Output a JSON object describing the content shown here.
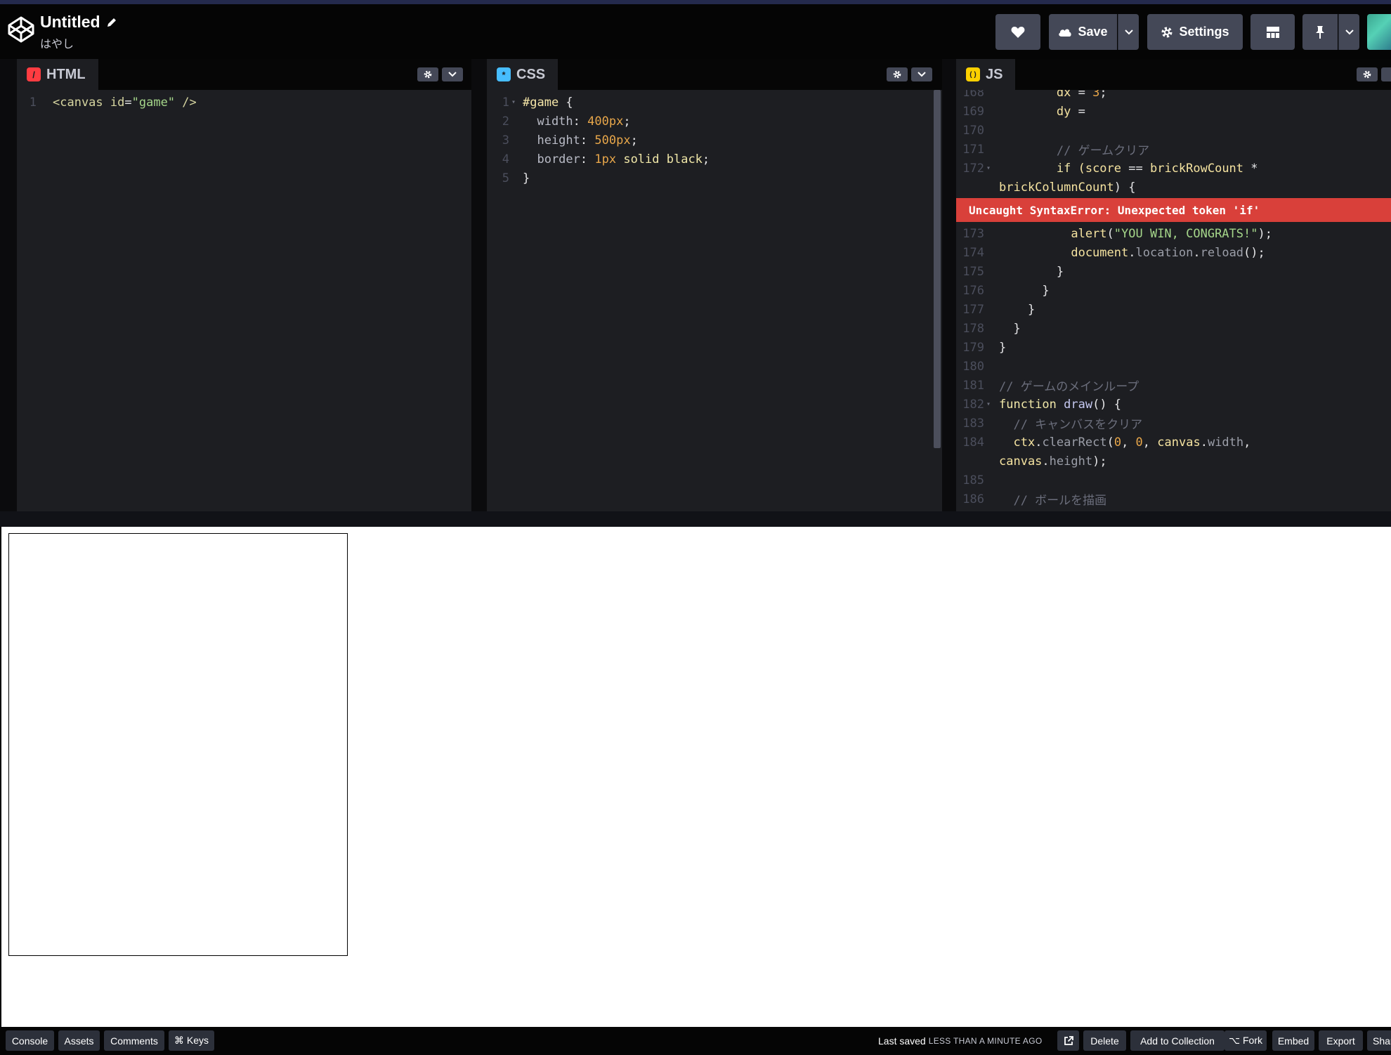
{
  "header": {
    "title": "Untitled",
    "author": "はやし",
    "save_label": "Save",
    "settings_label": "Settings",
    "heart_icon": "heart-icon",
    "cloud_icon": "cloud-icon",
    "gear_icon": "gear-icon",
    "layout_icon": "layout-icon",
    "pin_icon": "pin-icon"
  },
  "editors": {
    "html": {
      "label": "HTML",
      "badge": "/",
      "badge_color": "#ff3c41",
      "lines": [
        {
          "n": "1",
          "segments": [
            {
              "t": "<canvas ",
              "c": "tag"
            },
            {
              "t": "id",
              "c": "attr"
            },
            {
              "t": "=",
              "c": "plain"
            },
            {
              "t": "\"game\"",
              "c": "str"
            },
            {
              "t": " />",
              "c": "tag"
            }
          ]
        }
      ]
    },
    "css": {
      "label": "CSS",
      "badge": "*",
      "badge_color": "#47bdff",
      "lines": [
        {
          "n": "1",
          "fold": true,
          "segments": [
            {
              "t": "#game",
              "c": "sel"
            },
            {
              "t": " {",
              "c": "plain"
            }
          ]
        },
        {
          "n": "2",
          "segments": [
            {
              "t": "  width",
              "c": "prop"
            },
            {
              "t": ": ",
              "c": "plain"
            },
            {
              "t": "400px",
              "c": "num"
            },
            {
              "t": ";",
              "c": "plain"
            }
          ]
        },
        {
          "n": "3",
          "segments": [
            {
              "t": "  height",
              "c": "prop"
            },
            {
              "t": ": ",
              "c": "plain"
            },
            {
              "t": "500px",
              "c": "num"
            },
            {
              "t": ";",
              "c": "plain"
            }
          ]
        },
        {
          "n": "4",
          "segments": [
            {
              "t": "  border",
              "c": "prop"
            },
            {
              "t": ": ",
              "c": "plain"
            },
            {
              "t": "1px",
              "c": "num"
            },
            {
              "t": " solid black",
              "c": "kw"
            },
            {
              "t": ";",
              "c": "plain"
            }
          ]
        },
        {
          "n": "5",
          "segments": [
            {
              "t": "}",
              "c": "plain"
            }
          ]
        }
      ]
    },
    "js": {
      "label": "JS",
      "badge": "( )",
      "badge_color": "#fcd000",
      "error": "Uncaught SyntaxError: Unexpected token 'if'",
      "lines_before": [
        {
          "n": "168",
          "segments": [
            {
              "t": "        dx ",
              "c": "ident"
            },
            {
              "t": "= ",
              "c": "plain"
            },
            {
              "t": "3",
              "c": "num"
            },
            {
              "t": ";",
              "c": "plain"
            }
          ]
        },
        {
          "n": "169",
          "segments": [
            {
              "t": "        dy ",
              "c": "ident"
            },
            {
              "t": "=",
              "c": "plain"
            }
          ]
        },
        {
          "n": "170",
          "segments": []
        },
        {
          "n": "171",
          "segments": [
            {
              "t": "        // ゲームクリア",
              "c": "cmt"
            }
          ]
        },
        {
          "n": "172",
          "fold": true,
          "segments": [
            {
              "t": "        if ",
              "c": "kw"
            },
            {
              "t": "(score ",
              "c": "ident"
            },
            {
              "t": "== ",
              "c": "plain"
            },
            {
              "t": "brickRowCount ",
              "c": "ident"
            },
            {
              "t": "*",
              "c": "plain"
            }
          ]
        },
        {
          "n": "",
          "segments": [
            {
              "t": "brickColumnCount",
              "c": "ident"
            },
            {
              "t": ") {",
              "c": "plain"
            }
          ]
        }
      ],
      "lines_after": [
        {
          "n": "173",
          "segments": [
            {
              "t": "          alert",
              "c": "ident"
            },
            {
              "t": "(",
              "c": "plain"
            },
            {
              "t": "\"YOU WIN, CONGRATS!\"",
              "c": "str"
            },
            {
              "t": ");",
              "c": "plain"
            }
          ]
        },
        {
          "n": "174",
          "segments": [
            {
              "t": "          document",
              "c": "ident"
            },
            {
              "t": ".",
              "c": "plain"
            },
            {
              "t": "location",
              "c": "dim"
            },
            {
              "t": ".",
              "c": "plain"
            },
            {
              "t": "reload",
              "c": "dim"
            },
            {
              "t": "();",
              "c": "plain"
            }
          ]
        },
        {
          "n": "175",
          "segments": [
            {
              "t": "        }",
              "c": "plain"
            }
          ]
        },
        {
          "n": "176",
          "segments": [
            {
              "t": "      }",
              "c": "plain"
            }
          ]
        },
        {
          "n": "177",
          "segments": [
            {
              "t": "    }",
              "c": "plain"
            }
          ]
        },
        {
          "n": "178",
          "segments": [
            {
              "t": "  }",
              "c": "plain"
            }
          ]
        },
        {
          "n": "179",
          "segments": [
            {
              "t": "}",
              "c": "plain"
            }
          ]
        },
        {
          "n": "180",
          "segments": []
        },
        {
          "n": "181",
          "segments": [
            {
              "t": "// ゲームのメインループ",
              "c": "cmt"
            }
          ]
        },
        {
          "n": "182",
          "fold": true,
          "segments": [
            {
              "t": "function ",
              "c": "kw"
            },
            {
              "t": "draw",
              "c": "fn"
            },
            {
              "t": "() {",
              "c": "plain"
            }
          ]
        },
        {
          "n": "183",
          "segments": [
            {
              "t": "  // キャンバスをクリア",
              "c": "cmt"
            }
          ]
        },
        {
          "n": "184",
          "segments": [
            {
              "t": "  ctx",
              "c": "ident"
            },
            {
              "t": ".",
              "c": "plain"
            },
            {
              "t": "clearRect",
              "c": "dim"
            },
            {
              "t": "(",
              "c": "plain"
            },
            {
              "t": "0",
              "c": "num"
            },
            {
              "t": ", ",
              "c": "plain"
            },
            {
              "t": "0",
              "c": "num"
            },
            {
              "t": ", ",
              "c": "plain"
            },
            {
              "t": "canvas",
              "c": "ident"
            },
            {
              "t": ".",
              "c": "plain"
            },
            {
              "t": "width",
              "c": "dim"
            },
            {
              "t": ",",
              "c": "plain"
            }
          ]
        },
        {
          "n": "",
          "segments": [
            {
              "t": "canvas",
              "c": "ident"
            },
            {
              "t": ".",
              "c": "plain"
            },
            {
              "t": "height",
              "c": "dim"
            },
            {
              "t": ");",
              "c": "plain"
            }
          ]
        },
        {
          "n": "185",
          "segments": []
        },
        {
          "n": "186",
          "segments": [
            {
              "t": "  // ボールを描画",
              "c": "cmt"
            }
          ]
        }
      ]
    }
  },
  "footer": {
    "console": "Console",
    "assets": "Assets",
    "comments": "Comments",
    "keys": "⌘ Keys",
    "last_saved": "Last saved",
    "last_saved_when": "LESS THAN A MINUTE AGO",
    "delete": "Delete",
    "add_to_collection": "Add to Collection",
    "fork": "⌥ Fork",
    "embed": "Embed",
    "export": "Export",
    "share": "Shar"
  }
}
